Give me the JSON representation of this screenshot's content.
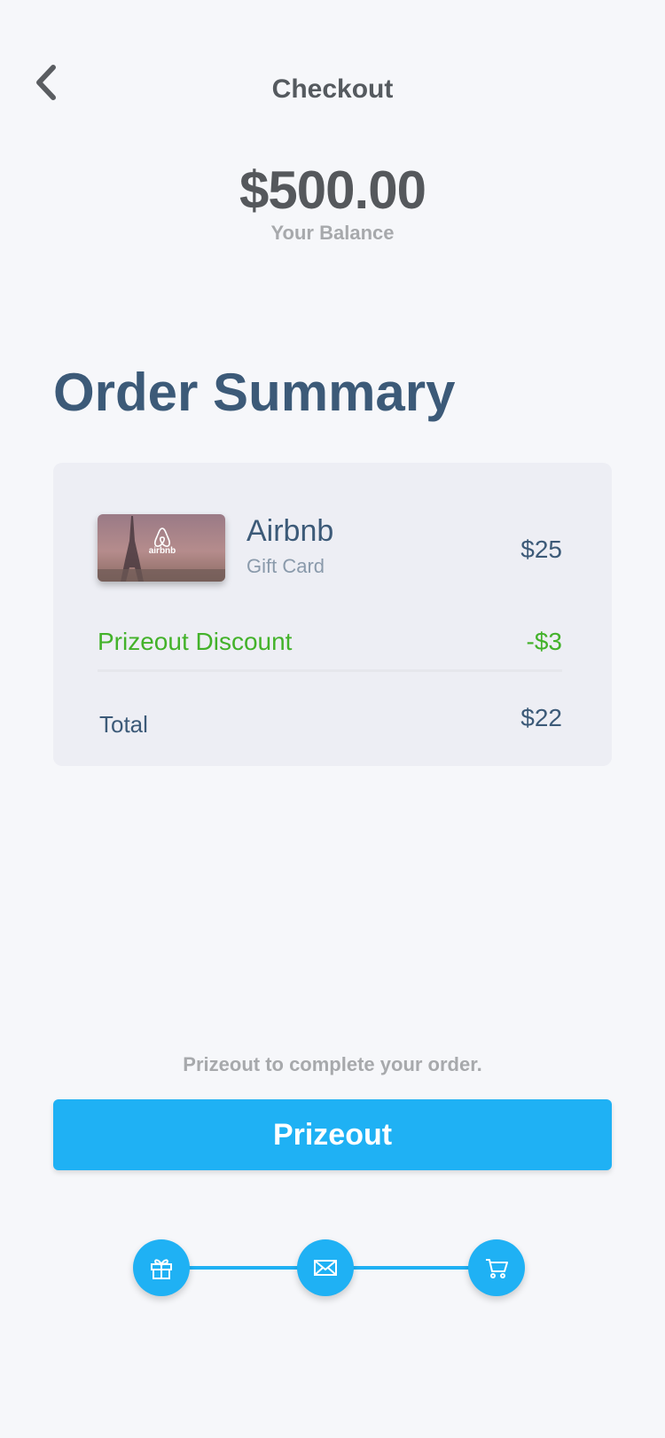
{
  "header": {
    "title": "Checkout",
    "back_icon": "chevron-left-icon"
  },
  "balance": {
    "amount": "$500.00",
    "label": "Your Balance"
  },
  "order": {
    "heading": "Order Summary",
    "item": {
      "name": "Airbnb",
      "subtitle": "Gift Card",
      "price": "$25",
      "brand_text": "airbnb"
    },
    "discount": {
      "label": "Prizeout Discount",
      "value": "-$3"
    },
    "total": {
      "label": "Total",
      "value": "$22"
    }
  },
  "cta": {
    "helper": "Prizeout to complete your order.",
    "button_label": "Prizeout"
  },
  "stepper": {
    "steps": [
      {
        "icon": "gift-icon"
      },
      {
        "icon": "envelope-icon"
      },
      {
        "icon": "cart-icon"
      }
    ]
  },
  "colors": {
    "accent": "#1fb1f4",
    "heading": "#3c5a78",
    "discount": "#43b22a",
    "background": "#f6f7fa",
    "card": "#edeef4"
  }
}
